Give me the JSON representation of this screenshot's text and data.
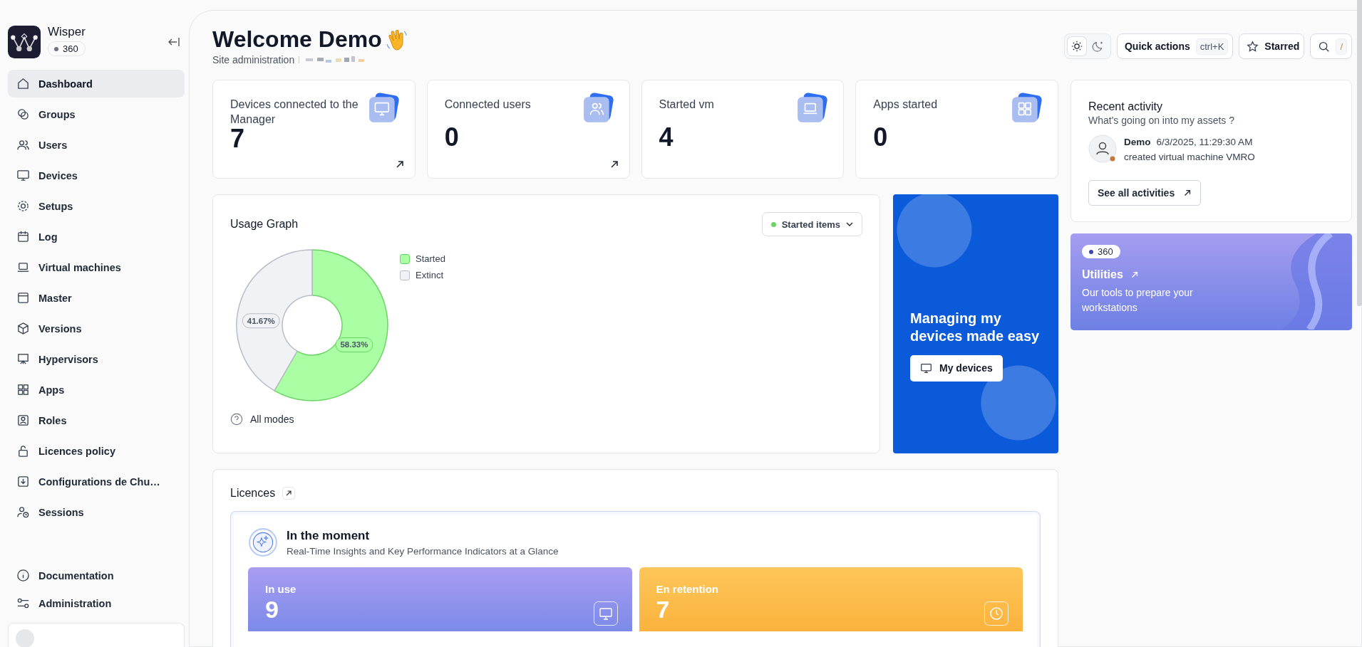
{
  "sidebar": {
    "app_name": "Wisper",
    "badge": "360",
    "items": [
      {
        "label": "Dashboard",
        "selected": true
      },
      {
        "label": "Groups",
        "selected": false
      },
      {
        "label": "Users",
        "selected": false
      },
      {
        "label": "Devices",
        "selected": false
      },
      {
        "label": "Setups",
        "selected": false
      },
      {
        "label": "Log",
        "selected": false
      },
      {
        "label": "Virtual machines",
        "selected": false
      },
      {
        "label": "Master",
        "selected": false
      },
      {
        "label": "Versions",
        "selected": false
      },
      {
        "label": "Hypervisors",
        "selected": false
      },
      {
        "label": "Apps",
        "selected": false
      },
      {
        "label": "Roles",
        "selected": false
      },
      {
        "label": "Licences policy",
        "selected": false
      },
      {
        "label": "Configurations de Chu…",
        "selected": false
      },
      {
        "label": "Sessions",
        "selected": false
      }
    ],
    "footer_items": [
      {
        "label": "Documentation"
      },
      {
        "label": "Administration"
      }
    ]
  },
  "header": {
    "title": "Welcome Demo",
    "subtitle": "Site administration",
    "quick_actions": "Quick actions",
    "shortcut": "ctrl+K",
    "starred": "Starred",
    "dark_mode": false,
    "search_shortcut": "/"
  },
  "stats": [
    {
      "label": "Devices connected to the Manager",
      "value": "7",
      "link": true
    },
    {
      "label": "Connected users",
      "value": "0",
      "link": true
    },
    {
      "label": "Started vm",
      "value": "4",
      "link": false
    },
    {
      "label": "Apps started",
      "value": "0",
      "link": false
    }
  ],
  "usage": {
    "title": "Usage Graph",
    "filter": "Started items",
    "footer": "All modes",
    "chart_data": {
      "type": "donut",
      "legend": "right",
      "categories": [
        "Started",
        "Extinct"
      ],
      "values": [
        58.33,
        41.67
      ],
      "value_labels": [
        "58.33%",
        "41.67%"
      ]
    }
  },
  "promo": {
    "title": "Managing my devices made easy",
    "button": "My devices"
  },
  "activity": {
    "title": "Recent activity",
    "subtitle": "What's going on into my assets ?",
    "entries": [
      {
        "user": "Demo",
        "time": "6/3/2025, 11:29:30 AM",
        "text": "created virtual machine VMRO"
      }
    ],
    "button": "See all activities"
  },
  "utilities": {
    "badge": "360",
    "title": "Utilities",
    "text": "Our tools to prepare your workstations"
  },
  "licences": {
    "title": "Licences",
    "section_title": "In the moment",
    "section_subtitle": "Real-Time Insights and Key Performance Indicators at a Glance",
    "cards": [
      {
        "kind": "purple",
        "label": "In use",
        "value": "9"
      },
      {
        "kind": "orange",
        "label": "En retention",
        "value": "7"
      }
    ]
  }
}
